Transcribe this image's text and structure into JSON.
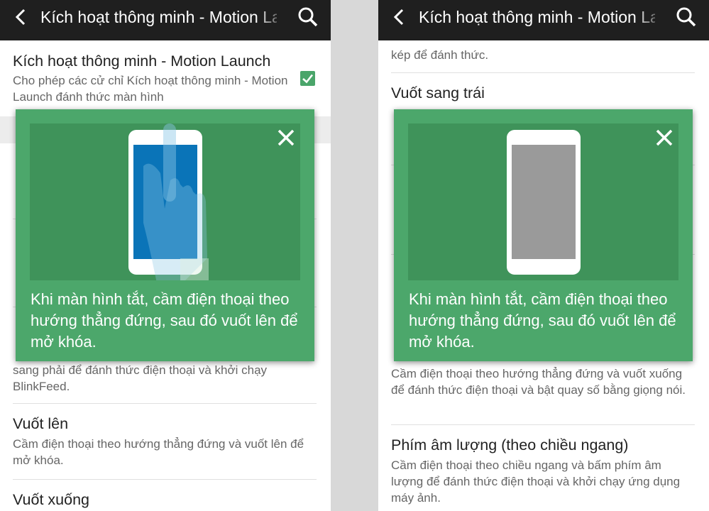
{
  "colors": {
    "appbar": "#1f1f1f",
    "accent_green": "#4ca76b",
    "illustration_bg": "#3f935a",
    "screen_on": "#0a74b8",
    "screen_off": "#9a9a9a"
  },
  "left": {
    "appbar": {
      "title": "Kích hoạt thông minh - Motion Launch",
      "back_icon": "back-arrow-icon",
      "search_icon": "search-icon"
    },
    "main_setting": {
      "title": "Kích hoạt thông minh - Motion Launch",
      "desc": "Cho phép các cử chỉ Kích hoạt thông minh - Motion Launch đánh thức màn hình",
      "checked": true
    },
    "partial_desc": "sang phải để đánh thức điện thoại và khởi chạy BlinkFeed.",
    "items": [
      {
        "title": "Vuốt lên",
        "desc": "Cầm điện thoại theo hướng thẳng đứng và vuốt lên để mở khóa."
      },
      {
        "title": "Vuốt xuống",
        "desc": ""
      }
    ],
    "popup": {
      "text": "Khi màn hình tắt, cầm điện thoại theo hướng thẳng đứng, sau đó vuốt lên để mở khóa.",
      "close_icon": "close-icon"
    }
  },
  "right": {
    "appbar": {
      "title": "Kích hoạt thông minh - Motion Launch",
      "back_icon": "back-arrow-icon",
      "search_icon": "search-icon"
    },
    "partial_top": "kép để đánh thức.",
    "items": [
      {
        "title": "Vuốt sang trái",
        "desc": ""
      },
      {
        "title": "",
        "desc": "Cầm điện thoại theo hướng thẳng đứng và vuốt xuống để đánh thức điện thoại và bật quay số bằng giọng nói."
      },
      {
        "title": "Phím âm lượng (theo chiều ngang)",
        "desc": "Cầm điện thoại theo chiều ngang và bấm phím âm lượng để đánh thức điện thoại và khởi chạy ứng dụng máy ảnh."
      }
    ],
    "popup": {
      "text": "Khi màn hình tắt, cầm điện thoại theo hướng thẳng đứng, sau đó vuốt lên để mở khóa.",
      "close_icon": "close-icon"
    }
  }
}
